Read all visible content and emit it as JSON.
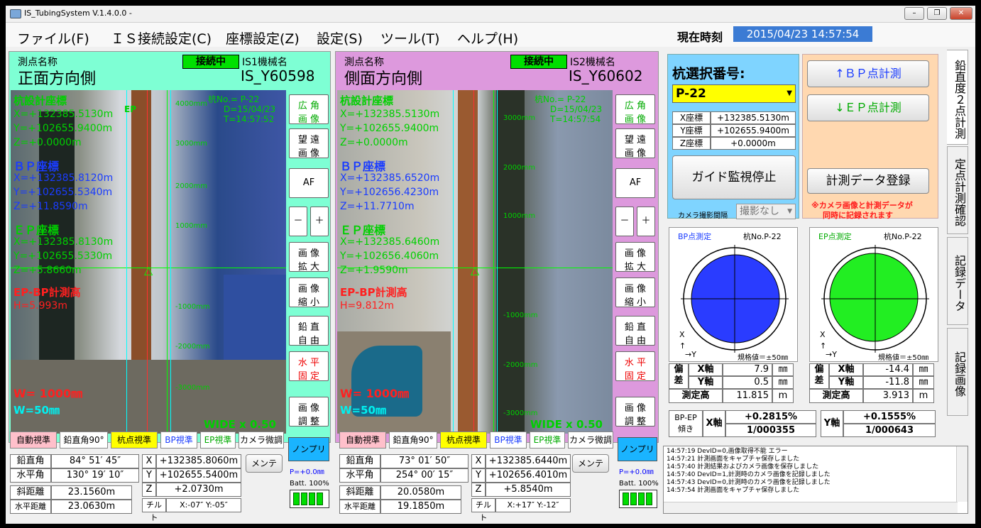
{
  "window": {
    "title": "IS_TubingSystem V.1.4.0.0 -",
    "min": "–",
    "max": "❐",
    "close": "✕"
  },
  "menu": [
    "ファイル(F)",
    "ＩＳ接続設定(C)",
    "座標設定(Z)",
    "設定(S)",
    "ツール(T)",
    "ヘルプ(H)"
  ],
  "clock": {
    "label": "現在時刻",
    "value": "2015/04/23 14:57:54"
  },
  "left": {
    "point_label": "測点名称",
    "direction": "正面方向側",
    "status": "接続中",
    "machine_label": "IS1機械名",
    "machine": "IS_Y60598",
    "pile_no": "杭No.= P-22",
    "date": "D=15/04/23",
    "time": "T=14:57:52",
    "design_title": "杭設計座標",
    "design_x": "X=+132385.5130m",
    "design_y": "Y=+102655.9400m",
    "design_z": "Z=+0.0000m",
    "bp_title": "ＢＰ座標",
    "bp_x": "X=+132385.8120m",
    "bp_y": "Y=+102655.5340m",
    "bp_z": "Z=+11.8590m",
    "ep_title": "ＥＰ座標",
    "ep_x": "X=+132385.8130m",
    "ep_y": "Y=+102655.5330m",
    "ep_z": "Z=+5.8660m",
    "h_title": "EP-BP計測高",
    "h": "H=5.993m",
    "w1": "W= 1000㎜",
    "w2": "W=50㎜",
    "zoom": "WIDE x 0.50",
    "scale": [
      "4000mm",
      "3000mm",
      "2000mm",
      "1000mm",
      "-1000mm",
      "-2000mm",
      "-3000mm"
    ],
    "ep_mark": "EP",
    "side": [
      "広 角\n画 像",
      "望 遠\n画 像",
      "AF",
      "－",
      "＋",
      "画 像\n拡 大",
      "画 像\n縮 小",
      "鉛 直\n自 由",
      "水 平\n固 定",
      "画 像\n調 整"
    ],
    "buttons": [
      "自動視準",
      "鉛直角90°",
      "杭点視準",
      "BP視準",
      "EP視準",
      "カメラ微調"
    ],
    "nonpuri": "ノンプリ",
    "p": "P=+0.0㎜",
    "batt": "Batt. 100%",
    "vangle_l": "鉛直角",
    "vangle": "84° 51′ 45″",
    "hangle_l": "水平角",
    "hangle": "130° 19′ 10″",
    "sdist_l": "斜距離",
    "sdist": "23.1560m",
    "hdist_l": "水平距離",
    "hdist": "23.0630m",
    "x_l": "X",
    "x": "+132385.8060m",
    "y_l": "Y",
    "y": "+102655.5400m",
    "z_l": "Z",
    "z": "+2.0730m",
    "tilt_l": "チルト",
    "tilt": "X:-07″ Y:-05″",
    "mente": "メンテ"
  },
  "right": {
    "point_label": "測点名称",
    "direction": "側面方向側",
    "status": "接続中",
    "machine_label": "IS2機械名",
    "machine": "IS_Y60602",
    "pile_no": "杭No.= P-22",
    "date": "D=15/04/23",
    "time": "T=14:57:54",
    "design_title": "杭設計座標",
    "design_x": "X=+132385.5130m",
    "design_y": "Y=+102655.9400m",
    "design_z": "Z=+0.0000m",
    "bp_title": "ＢＰ座標",
    "bp_x": "X=+132385.6520m",
    "bp_y": "Y=+102656.4230m",
    "bp_z": "Z=+11.7710m",
    "ep_title": "ＥＰ座標",
    "ep_x": "X=+132385.6460m",
    "ep_y": "Y=+102656.4060m",
    "ep_z": "Z=+1.9590m",
    "h_title": "EP-BP計測高",
    "h": "H=9.812m",
    "w1": "W= 1000㎜",
    "w2": "W=50㎜",
    "zoom": "WIDE x 0.50",
    "scale": [
      "3000mm",
      "2000mm",
      "1000mm",
      "-1000mm",
      "-2000mm",
      "-3000mm"
    ],
    "side": [
      "広 角\n画 像",
      "望 遠\n画 像",
      "AF",
      "－",
      "＋",
      "画 像\n拡 大",
      "画 像\n縮 小",
      "鉛 直\n自 由",
      "水 平\n固 定",
      "画 像\n調 整"
    ],
    "buttons": [
      "自動視準",
      "鉛直角90°",
      "杭点視準",
      "BP視準",
      "EP視準",
      "カメラ微調"
    ],
    "nonpuri": "ノンプリ",
    "p": "P=+0.0㎜",
    "batt": "Batt. 100%",
    "vangle_l": "鉛直角",
    "vangle": "73° 01′ 50″",
    "hangle_l": "水平角",
    "hangle": "254° 00′ 15″",
    "sdist_l": "斜距離",
    "sdist": "20.0580m",
    "hdist_l": "水平距離",
    "hdist": "19.1850m",
    "x_l": "X",
    "x": "+132385.6440m",
    "y_l": "Y",
    "y": "+102656.4010m",
    "z_l": "Z",
    "z": "+5.8540m",
    "tilt_l": "チルト",
    "tilt": "X:+17″ Y:-12″",
    "mente": "メンテ"
  },
  "pile": {
    "title": "杭選択番号:",
    "selected": "P-22",
    "x_l": "X座標",
    "x": "+132385.5130m",
    "y_l": "Y座標",
    "y": "+102655.9400m",
    "z_l": "Z座標",
    "z": "+0.0000m",
    "guide_btn": "ガイド監視停止",
    "cam_interval_l": "カメラ撮影間隔",
    "cam_interval": "撮影なし"
  },
  "measure": {
    "bp_btn": "↑ＢＰ点計測",
    "ep_btn": "↓ＥＰ点計測",
    "reg_btn": "計測データ登録",
    "note1": "※カメラ画像と計測データが",
    "note2": "同時に記録されます"
  },
  "bp_target": {
    "title": "BP点測定",
    "pile": "杭No.P-22",
    "x": "X",
    "y": "→Y",
    "arrow": "↑",
    "spec": "規格値＝±50㎜",
    "color": "#2a3cff"
  },
  "ep_target": {
    "title": "EP点測定",
    "pile": "杭No.P-22",
    "x": "X",
    "y": "→Y",
    "arrow": "↑",
    "spec": "規格値＝±50㎜",
    "color": "#22ee22"
  },
  "deviation": {
    "label1": "偏",
    "label2": "差",
    "bp": {
      "xl": "X軸",
      "x": "7.9",
      "yl": "Y軸",
      "y": "0.5",
      "unit": "㎜",
      "hl": "測定高",
      "h": "11.815",
      "hu": "m"
    },
    "ep": {
      "xl": "X軸",
      "x": "-14.4",
      "yl": "Y軸",
      "y": "-11.8",
      "unit": "㎜",
      "hl": "測定高",
      "h": "3.913",
      "hu": "m"
    }
  },
  "tilt": {
    "label1": "BP-EP",
    "label2": "傾き",
    "xl": "X軸",
    "x_pct": "+0.2815%",
    "x_ratio": "1/000355",
    "yl": "Y軸",
    "y_pct": "+0.1555%",
    "y_ratio": "1/000643"
  },
  "tabs": [
    "鉛直度２点計測",
    "定点計測確認",
    "記録データ",
    "記録画像"
  ],
  "log": [
    "14:57:19 DevID=0,画像取得不能 エラー",
    "14:57:21 計測画面をキャプチャ保存しました",
    "14:57:40 計測結果およびカメラ画像を保存しました",
    "14:57:40 DevID=1,計測時のカメラ画像を記録しました",
    "14:57:43 DevID=0,計測時のカメラ画像を記録しました",
    "14:57:54 計測画面をキャプチャ保存しました"
  ]
}
